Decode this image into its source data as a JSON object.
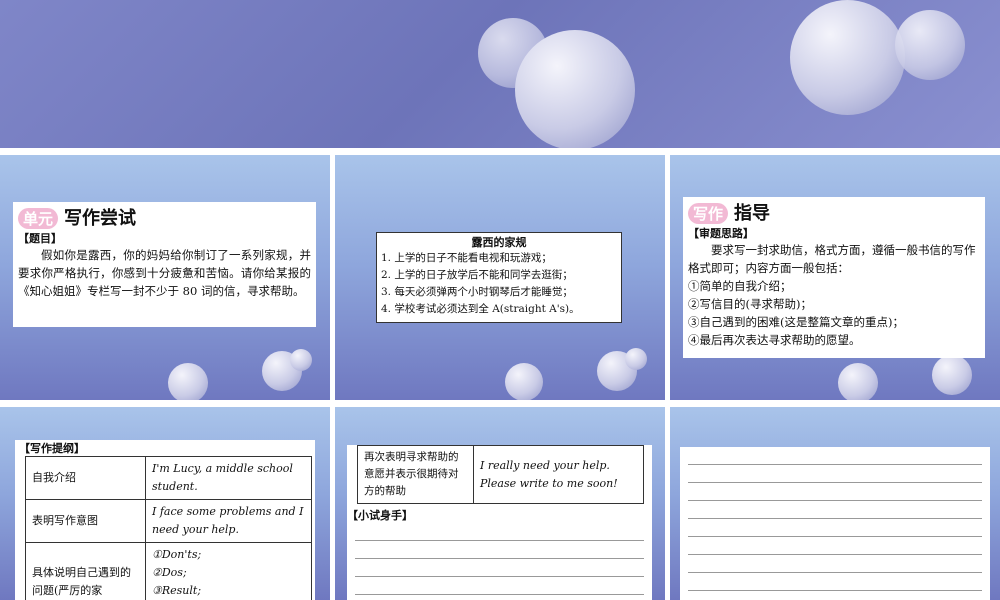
{
  "slide1": {
    "tag": "单元",
    "title": "写作尝试",
    "section": "【题目】",
    "body": "假如你是露西，你的妈妈给你制订了一系列家规，并要求你严格执行，你感到十分疲惫和苦恼。请你给某报的《知心姐姐》专栏写一封不少于 80 词的信，寻求帮助。"
  },
  "slide2": {
    "title": "露西的家规",
    "rules": [
      "1. 上学的日子不能看电视和玩游戏；",
      "2. 上学的日子放学后不能和同学去逛街；",
      "3. 每天必须弹两个小时钢琴后才能睡觉；",
      "4. 学校考试必须达到全 A(straight A's)。"
    ]
  },
  "slide3": {
    "tag": "写作",
    "title": "指导",
    "section": "【审题思路】",
    "intro": "要求写一封求助信，格式方面，遵循一般书信的写作格式即可；内容方面一般包括：",
    "points": [
      "①简单的自我介绍；",
      "②写信目的(寻求帮助)；",
      "③自己遇到的困难(这是整篇文章的重点)；",
      "④最后再次表达寻求帮助的愿望。"
    ]
  },
  "slide4": {
    "section": "【写作提纲】",
    "rows": [
      {
        "k": "自我介绍",
        "v": "I'm Lucy, a middle school student."
      },
      {
        "k": "表明写作意图",
        "v": "I face some problems and I need your help."
      },
      {
        "k": "具体说明自己遇到的问题(严厉的家",
        "v1": "①Don'ts;",
        "v2": "②Dos;",
        "v3": "③Result;"
      }
    ]
  },
  "slide5": {
    "row": {
      "k": "再次表明寻求帮助的意愿并表示很期待对方的帮助",
      "v1": "I really need your help.",
      "v2": "Please write to me soon!"
    },
    "section": "【小试身手】"
  }
}
